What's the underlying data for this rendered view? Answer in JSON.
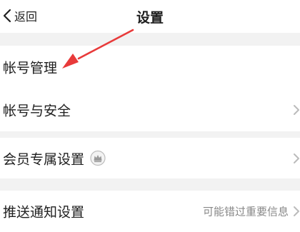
{
  "navbar": {
    "back_label": "返回",
    "title": "设置"
  },
  "groups": [
    {
      "items": [
        {
          "label": "帐号管理"
        },
        {
          "label": "帐号与安全"
        }
      ]
    },
    {
      "items": [
        {
          "label": "会员专属设置",
          "icon": "crown-icon"
        }
      ]
    },
    {
      "items": [
        {
          "label": "推送通知设置",
          "hint": "可能错过重要信息"
        }
      ]
    }
  ],
  "annotation": {
    "type": "arrow",
    "color": "#e83a3a",
    "target": "帐号管理"
  },
  "colors": {
    "page_background": "#f2f2f2",
    "row_background": "#ffffff",
    "text": "#1f1f1f",
    "hint": "#888888",
    "chevron": "#bbbbbb"
  }
}
